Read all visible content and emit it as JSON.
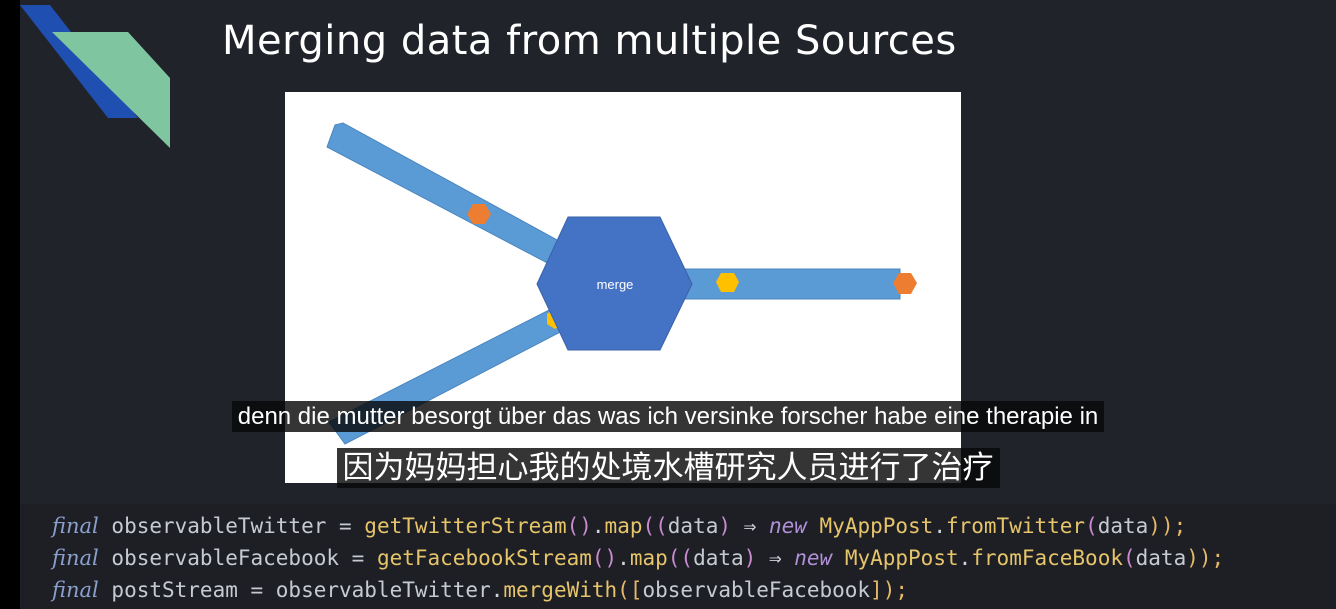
{
  "slide": {
    "title": "Merging data from multiple Sources"
  },
  "diagram": {
    "merge_label": "merge",
    "colors": {
      "stream": "#5b9bd5",
      "merge_hexagon": "#4472c4",
      "orange_event": "#ed7d31",
      "yellow_event": "#ffc000"
    }
  },
  "subtitles": {
    "german": "denn die mutter besorgt über das was ich versinke forscher habe eine therapie in",
    "chinese": "因为妈妈担心我的处境水槽研究人员进行了治疗"
  },
  "code": {
    "line1": {
      "kw": "final",
      "var": " observableTwitter = ",
      "fn1": "getTwitterStream",
      "p1": "()",
      "dot1": ".",
      "fn2": "map",
      "p2": "((",
      "arg": "data",
      "p3": ")",
      "arrow": " ⇒ ",
      "new": "new",
      "cls": " MyAppPost",
      "dot2": ".",
      "fn3": "fromTwitter",
      "p4": "(",
      "arg2": "data",
      "p5": "));"
    },
    "line2": {
      "kw": "final",
      "var": " observableFacebook = ",
      "fn1": "getFacebookStream",
      "p1": "()",
      "dot1": ".",
      "fn2": "map",
      "p2": "((",
      "arg": "data",
      "p3": ")",
      "arrow": " ⇒ ",
      "new": "new",
      "cls": " MyAppPost",
      "dot2": ".",
      "fn3": "fromFaceBook",
      "p4": "(",
      "arg2": "data",
      "p5": "));"
    },
    "line3": {
      "kw": "final",
      "var": " postStream = observableTwitter",
      "dot1": ".",
      "fn1": "mergeWith",
      "p1": "([",
      "arg": "observableFacebook",
      "p2": "]);"
    }
  }
}
